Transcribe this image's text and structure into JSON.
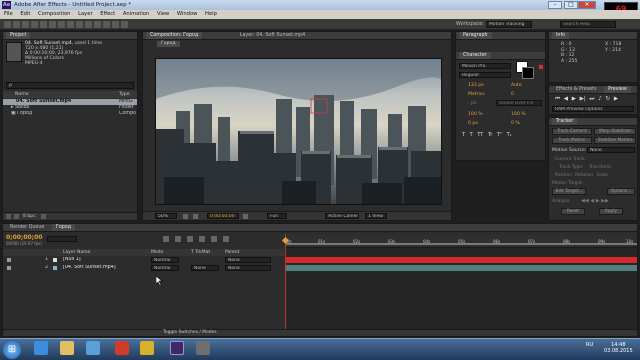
{
  "window": {
    "title": "Adobe After Effects - Untitled Project.aep *",
    "logo": "Ae",
    "min": "–",
    "max": "□",
    "close": "✕"
  },
  "clock_readout": "69",
  "menu": [
    "File",
    "Edit",
    "Composition",
    "Layer",
    "Effect",
    "Animation",
    "View",
    "Window",
    "Help"
  ],
  "workspace": {
    "label": "Workspace:",
    "value": "Motion Tracking",
    "search": "Search Help"
  },
  "project": {
    "tab": "Project",
    "selected_name": "04. Soft Sunset.mp4",
    "selected_used": ", used 1 time",
    "info": [
      "720 x 480 (1,21)",
      "Δ 0:00:10:00, 23,976 fps",
      "Millions of Colors",
      "MPEG-4"
    ],
    "search_placeholder": "ρ",
    "col_name": "Name",
    "col_type": "Type",
    "items": [
      {
        "name": "04. Soft Sunset.mp4",
        "type": "MPEG"
      },
      {
        "name": "Solids",
        "type": "Folder"
      },
      {
        "name": "Город",
        "type": "Compo"
      }
    ],
    "bpc": "8 bpc"
  },
  "composition": {
    "tab": "Composition: Город",
    "layer_tab": "Layer: 04. Soft Sunset.mp4",
    "comp_chip": "Город",
    "zoom": "50%",
    "time": "0;00;00;00",
    "resolution": "Full",
    "camera": "Active Camera",
    "view": "1 View"
  },
  "character": {
    "tabs": [
      "Character",
      "Paragraph"
    ],
    "font": "Minion Pro",
    "style": "Regular",
    "size": "133 px",
    "leading": "Auto",
    "kerning": "Metrics",
    "tracking": "0",
    "stroke": "- px",
    "stroke_mode": "Stroke Over Fill",
    "vscale": "100 %",
    "hscale": "100 %",
    "baseline": "0 px",
    "tsume": "0 %",
    "styles": [
      "T",
      "T",
      "TT",
      "Tr",
      "T¹",
      "T₁"
    ]
  },
  "info_panel": {
    "tab": "Info",
    "r": "R : 0",
    "g": "G : 13",
    "b": "B : 12",
    "a": "A : 255",
    "x": "X : 718",
    "y": "Y : 214"
  },
  "effects": {
    "tabs": [
      "Effects & Presets",
      "Preview"
    ],
    "ram": "RAM Preview Options"
  },
  "tracker": {
    "tab": "Tracker",
    "buttons": [
      "Track Camera",
      "Warp Stabilizer",
      "Track Motion",
      "Stabilize Motion"
    ],
    "source_label": "Motion Source:",
    "source_value": "None",
    "current_track": "Current Track:",
    "track_type": "Track Type:",
    "track_type_value": "Transform",
    "checks": [
      "Position",
      "Rotation",
      "Scale"
    ],
    "motion_target": "Motion Target:",
    "edit_target": "Edit Target...",
    "options": "Options...",
    "analyze": "Analyze:",
    "reset": "Reset",
    "apply": "Apply"
  },
  "timeline": {
    "tabs": [
      "Render Queue",
      "Город"
    ],
    "time": "0;00;00;00",
    "time_sub": "00000 (29.97 fps)",
    "cols": [
      "Layer Name",
      "Mode",
      "T TrkMat",
      "Parent"
    ],
    "layers": [
      {
        "num": "1",
        "name": "[Null 1]",
        "mode": "Normal",
        "trkmat": "",
        "parent": "None",
        "color": "#c8c8c8"
      },
      {
        "num": "2",
        "name": "[04. Soft Sunset.mp4]",
        "mode": "Normal",
        "trkmat": "None",
        "parent": "None",
        "color": "#8fb3c9"
      }
    ],
    "ruler": [
      "0s",
      "01s",
      "02s",
      "03s",
      "04s",
      "05s",
      "06s",
      "07s",
      "08s",
      "09s",
      "10s"
    ],
    "toggle": "Toggle Switches / Modes"
  },
  "taskbar": {
    "start": "⊞",
    "lang": "RU",
    "time": "14:48",
    "date": "03.08.2015"
  },
  "colors": {
    "timeline_bar_red": "#d42a2a",
    "layer_bar_teal": "#4f7f7f",
    "accent_orange": "#e0a23a",
    "playhead": "#e0a23a"
  }
}
